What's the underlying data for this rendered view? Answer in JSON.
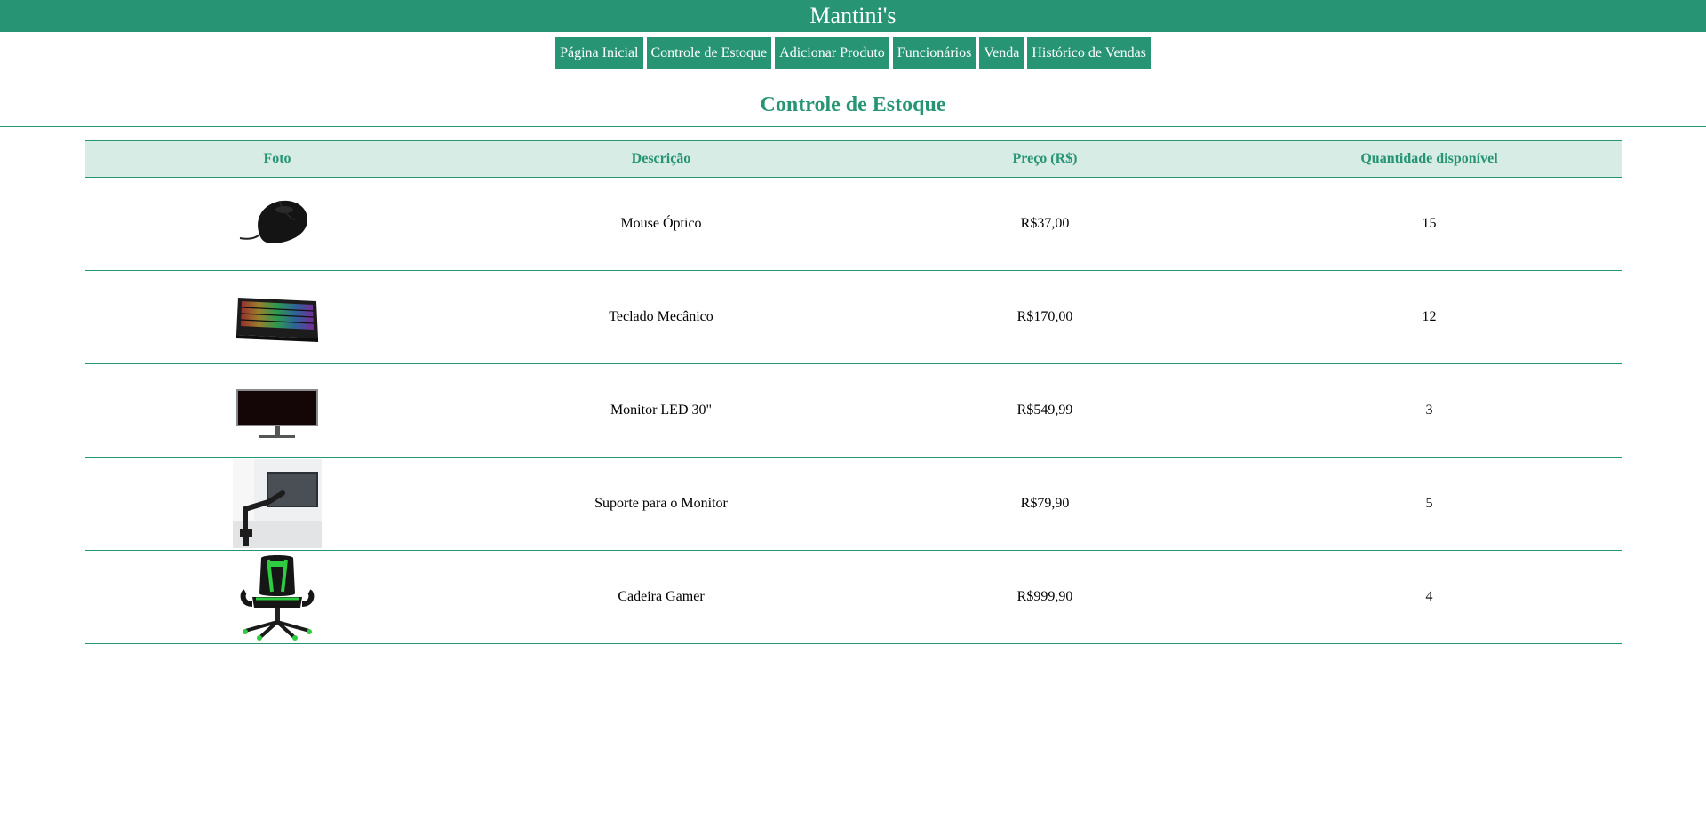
{
  "header": {
    "title": "Mantini's"
  },
  "nav": {
    "items": [
      {
        "label": "Página Inicial"
      },
      {
        "label": "Controle de Estoque"
      },
      {
        "label": "Adicionar Produto"
      },
      {
        "label": "Funcionários"
      },
      {
        "label": "Venda"
      },
      {
        "label": "Histórico de Vendas"
      }
    ]
  },
  "page": {
    "title": "Controle de Estoque"
  },
  "table": {
    "headers": [
      "Foto",
      "Descrição",
      "Preço (R$)",
      "Quantidade disponível"
    ],
    "rows": [
      {
        "photo_icon": "mouse-icon",
        "description": "Mouse Óptico",
        "price": "R$37,00",
        "quantity": "15"
      },
      {
        "photo_icon": "keyboard-icon",
        "description": "Teclado Mecânico",
        "price": "R$170,00",
        "quantity": "12"
      },
      {
        "photo_icon": "monitor-icon",
        "description": "Monitor LED 30\"",
        "price": "R$549,99",
        "quantity": "3"
      },
      {
        "photo_icon": "monitor-arm-icon",
        "description": "Suporte para o Monitor",
        "price": "R$79,90",
        "quantity": "5"
      },
      {
        "photo_icon": "gaming-chair-icon",
        "description": "Cadeira Gamer",
        "price": "R$999,90",
        "quantity": "4"
      }
    ]
  },
  "colors": {
    "brand": "#279474",
    "header_row_bg": "#d6ece4"
  }
}
